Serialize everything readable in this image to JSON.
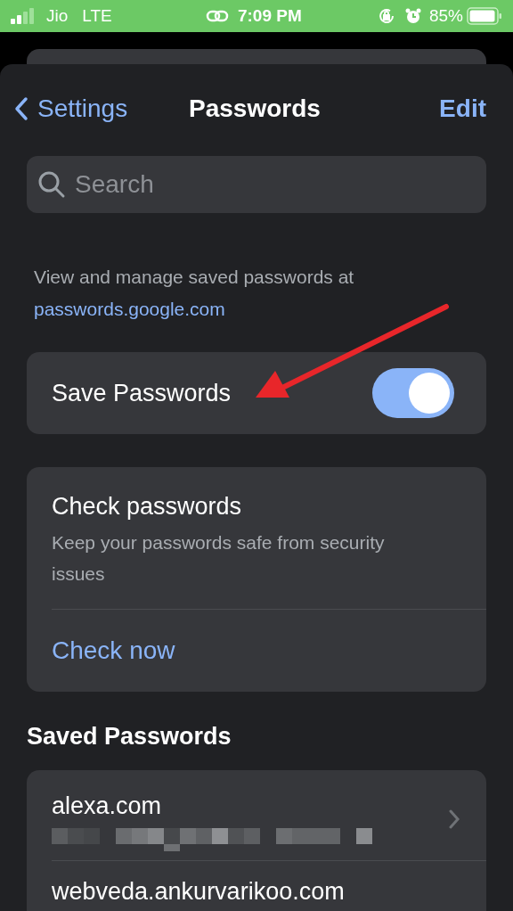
{
  "status_bar": {
    "carrier": "Jio",
    "network": "LTE",
    "time": "7:09 PM",
    "battery": "85%"
  },
  "nav": {
    "back": "Settings",
    "title": "Passwords",
    "action": "Edit"
  },
  "search": {
    "placeholder": "Search"
  },
  "info": {
    "text": "View and manage saved passwords at",
    "link": "passwords.google.com"
  },
  "save_passwords": {
    "label": "Save Passwords",
    "on": true
  },
  "check": {
    "title": "Check passwords",
    "description": "Keep your passwords safe from security issues",
    "action": "Check now"
  },
  "saved_heading": "Saved Passwords",
  "saved": [
    {
      "site": "alexa.com",
      "redacted": true
    },
    {
      "site": "webveda.ankurvarikoo.com",
      "redacted": false
    }
  ]
}
